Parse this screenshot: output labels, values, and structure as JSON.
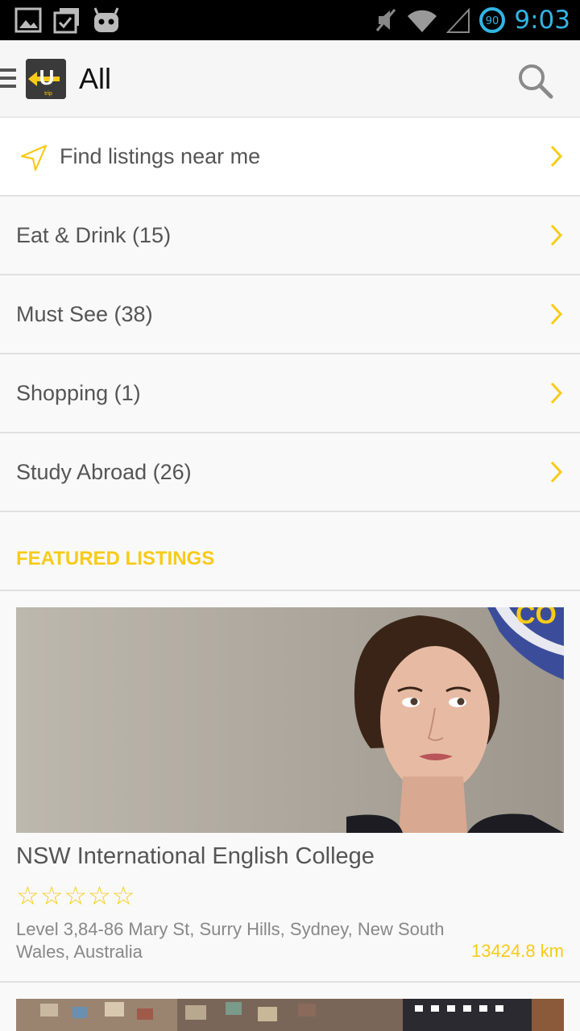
{
  "status_bar": {
    "time": "9:03",
    "battery_level": "90",
    "icons": [
      "gallery-icon",
      "task-check-icon",
      "android-robot-icon",
      "mute-icon",
      "wifi-icon",
      "signal-icon",
      "battery-icon"
    ]
  },
  "header": {
    "title": "All",
    "logo_text": "trip",
    "logo_letter": "U",
    "accent_color": "#f8cb17"
  },
  "nearby": {
    "label": "Find listings near me"
  },
  "categories": [
    {
      "label": "Eat & Drink (15)"
    },
    {
      "label": "Must See (38)"
    },
    {
      "label": "Shopping (1)"
    },
    {
      "label": "Study Abroad (26)"
    }
  ],
  "featured": {
    "heading": "FEATURED LISTINGS",
    "listing": {
      "title": "NSW International English College",
      "rating_stars": 0,
      "stars_text": "☆☆☆☆☆",
      "address": "Level 3,84-86 Mary St, Surry Hills, Sydney, New South Wales, Australia",
      "distance": "13424.8 km",
      "banner_text": "CO"
    }
  }
}
